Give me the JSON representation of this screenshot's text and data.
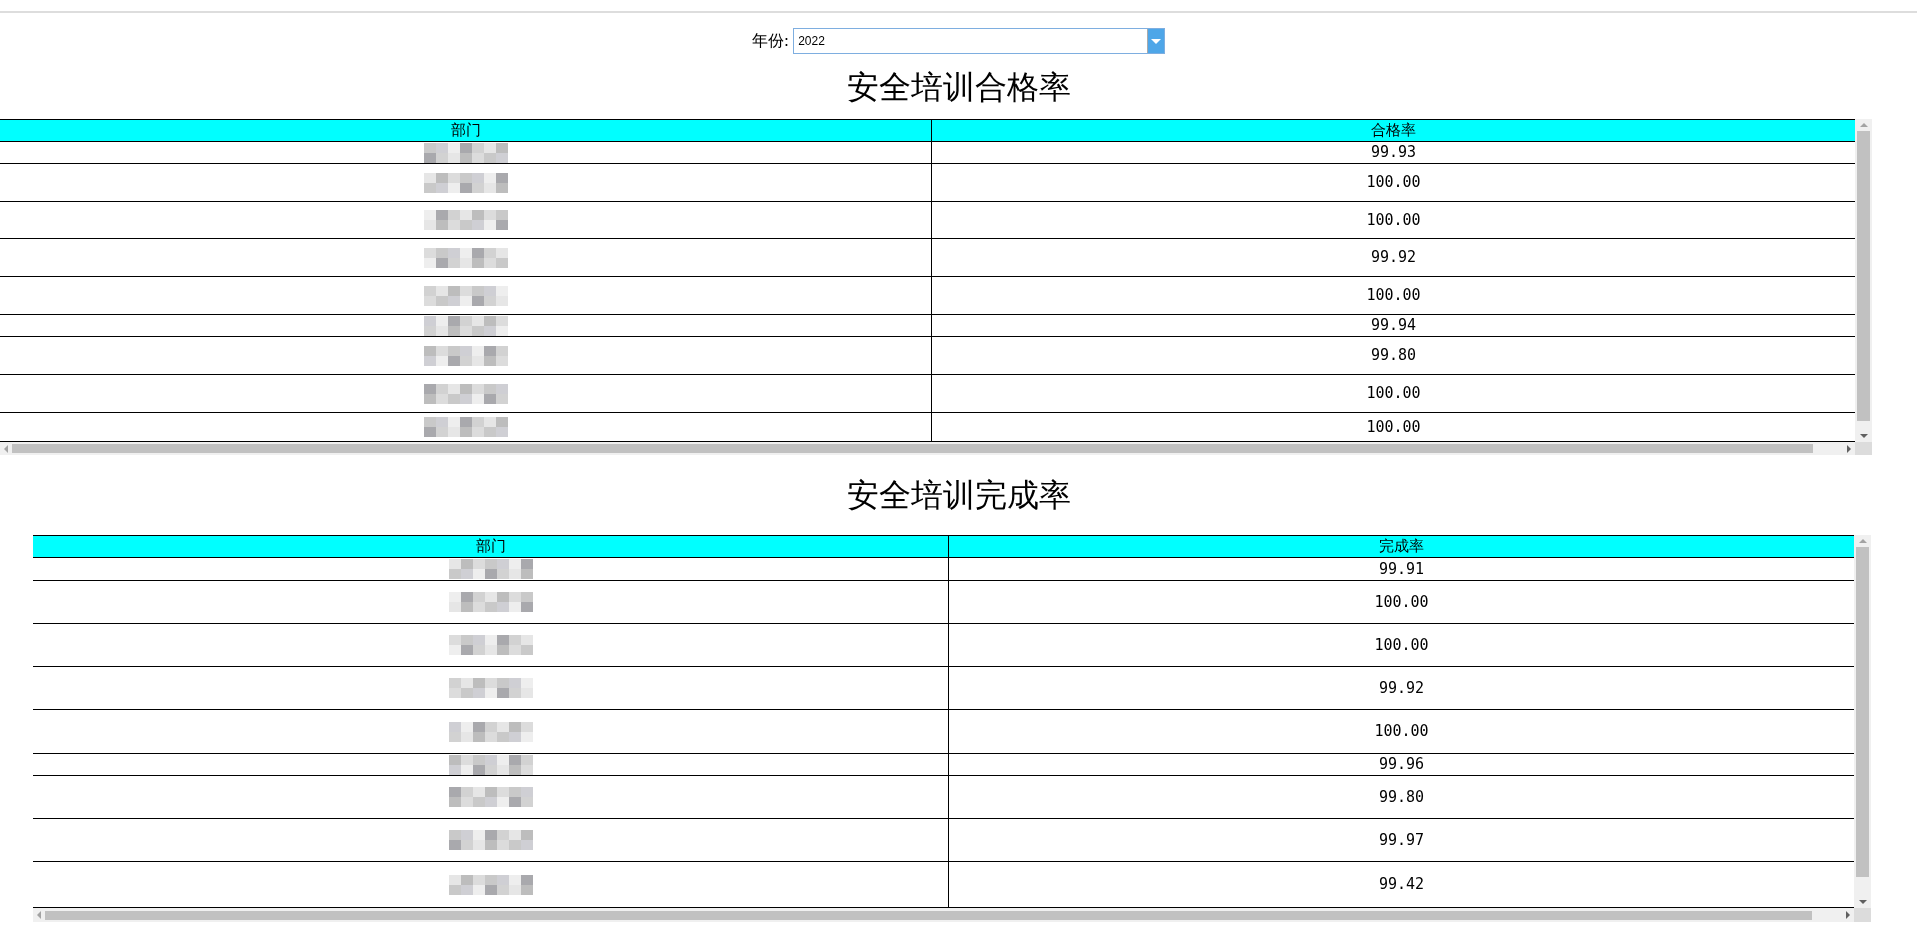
{
  "filter": {
    "label": "年份:",
    "value": "2022"
  },
  "tables": [
    {
      "title": "安全培训合格率",
      "columns": [
        "部门",
        "合格率"
      ],
      "rows": [
        {
          "rate": "99.93"
        },
        {
          "rate": "100.00"
        },
        {
          "rate": "100.00"
        },
        {
          "rate": "99.92"
        },
        {
          "rate": "100.00"
        },
        {
          "rate": "99.94"
        },
        {
          "rate": "99.80"
        },
        {
          "rate": "100.00"
        },
        {
          "rate": "100.00"
        }
      ]
    },
    {
      "title": "安全培训完成率",
      "columns": [
        "部门",
        "完成率"
      ],
      "rows": [
        {
          "rate": "99.91"
        },
        {
          "rate": "100.00"
        },
        {
          "rate": "100.00"
        },
        {
          "rate": "99.92"
        },
        {
          "rate": "100.00"
        },
        {
          "rate": "99.96"
        },
        {
          "rate": "99.80"
        },
        {
          "rate": "99.97"
        },
        {
          "rate": "99.42"
        }
      ]
    }
  ]
}
